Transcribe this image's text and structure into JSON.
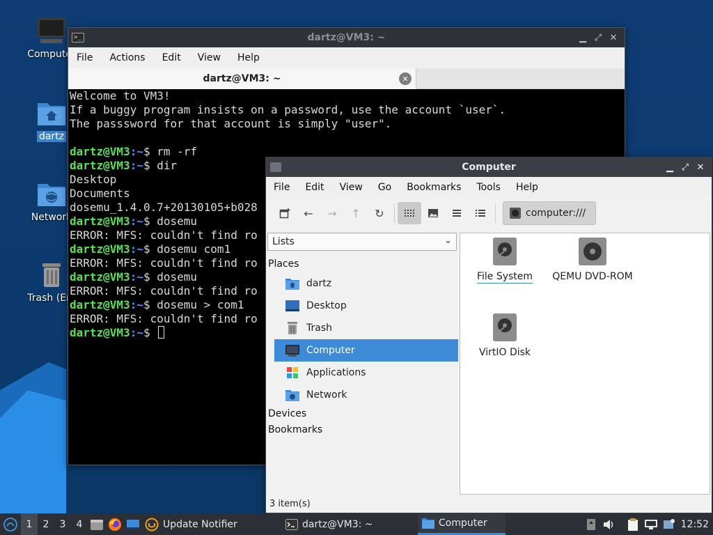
{
  "colors": {
    "desktop": "#0f3d73",
    "accent": "#3d8ad6",
    "terminal_bg": "#000000",
    "prompt_user": "#5ce05c",
    "prompt_path": "#5c8ff0"
  },
  "desktop": {
    "icons": [
      {
        "label": "Computer",
        "icon": "computer-icon"
      },
      {
        "label": "dartz",
        "icon": "home-folder-icon"
      },
      {
        "label": "Network",
        "icon": "network-folder-icon"
      },
      {
        "label": "Trash (Em",
        "icon": "trash-icon"
      }
    ]
  },
  "terminal": {
    "title": "dartz@VM3: ~",
    "menu": [
      "File",
      "Actions",
      "Edit",
      "View",
      "Help"
    ],
    "tab_title": "dartz@VM3: ~",
    "prompt_user": "dartz@VM3",
    "prompt_path": ":~",
    "prompt_sign": "$ ",
    "lines": [
      {
        "type": "out",
        "text": "Welcome to VM3!"
      },
      {
        "type": "out",
        "text": "If a buggy program insists on a password, use the account `user`."
      },
      {
        "type": "out",
        "text": "The passsword for that account is simply \"user\"."
      },
      {
        "type": "out",
        "text": ""
      },
      {
        "type": "cmd",
        "text": "rm -rf"
      },
      {
        "type": "cmd",
        "text": "dir"
      },
      {
        "type": "out",
        "text": "Desktop"
      },
      {
        "type": "out",
        "text": "Documents"
      },
      {
        "type": "out",
        "text": "dosemu_1.4.0.7+20130105+b028"
      },
      {
        "type": "cmd",
        "text": "dosemu"
      },
      {
        "type": "out",
        "text": "ERROR: MFS: couldn't find ro"
      },
      {
        "type": "cmd",
        "text": "dosemu com1"
      },
      {
        "type": "out",
        "text": "ERROR: MFS: couldn't find ro"
      },
      {
        "type": "cmd",
        "text": "dosemu"
      },
      {
        "type": "out",
        "text": "ERROR: MFS: couldn't find ro"
      },
      {
        "type": "cmd",
        "text": "dosemu > com1"
      },
      {
        "type": "out",
        "text": "ERROR: MFS: couldn't find ro"
      },
      {
        "type": "cmd",
        "text": "",
        "cursor": true
      }
    ]
  },
  "filemanager": {
    "title": "Computer",
    "menu": [
      "File",
      "Edit",
      "View",
      "Go",
      "Bookmarks",
      "Tools",
      "Help"
    ],
    "location": "computer:///",
    "side_select": "Lists",
    "headings": {
      "places": "Places",
      "devices": "Devices",
      "bookmarks": "Bookmarks"
    },
    "places": [
      {
        "label": "dartz",
        "icon": "home-folder-icon"
      },
      {
        "label": "Desktop",
        "icon": "desktop-icon"
      },
      {
        "label": "Trash",
        "icon": "trash-icon"
      },
      {
        "label": "Computer",
        "icon": "computer-icon",
        "selected": true
      },
      {
        "label": "Applications",
        "icon": "applications-icon"
      },
      {
        "label": "Network",
        "icon": "network-folder-icon"
      }
    ],
    "items": [
      {
        "label": "File System",
        "icon": "drive-icon"
      },
      {
        "label": "QEMU DVD-ROM",
        "icon": "optical-drive-icon"
      },
      {
        "label": "VirtIO Disk",
        "icon": "drive-icon"
      }
    ],
    "status": "3 item(s)"
  },
  "taskbar": {
    "workspaces": [
      "1",
      "2",
      "3",
      "4"
    ],
    "active_workspace": "1",
    "tasks": [
      {
        "label": "Update Notifier",
        "icon": "update-notifier-icon"
      },
      {
        "label": "dartz@VM3: ~",
        "icon": "terminal-icon"
      },
      {
        "label": "Computer",
        "icon": "folder-icon",
        "active": true
      }
    ],
    "clock": "12:52"
  }
}
